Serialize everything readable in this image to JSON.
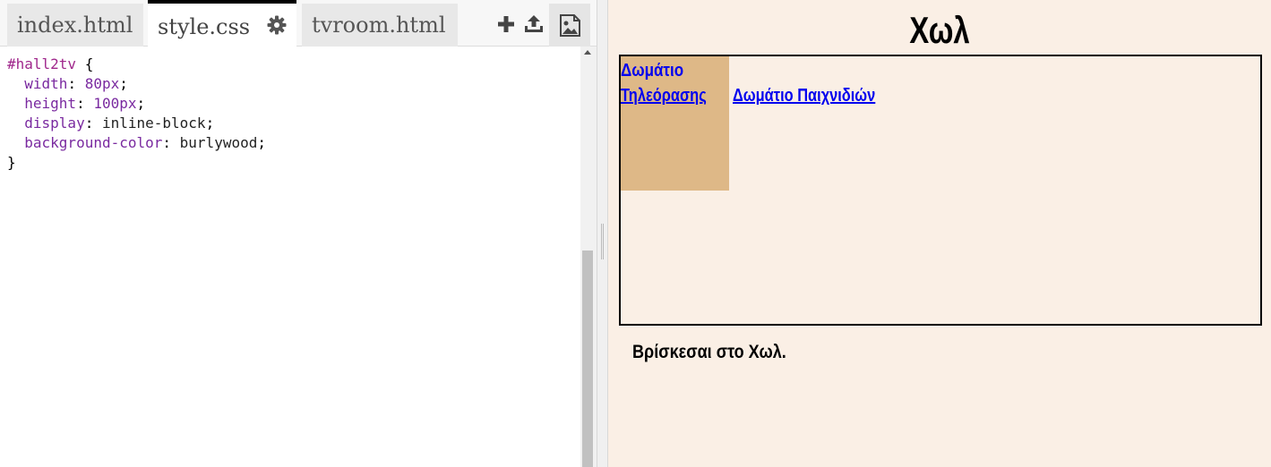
{
  "editor": {
    "tabs": [
      {
        "label": "index.html",
        "active": false
      },
      {
        "label": "style.css",
        "active": true
      },
      {
        "label": "tvroom.html",
        "active": false
      }
    ],
    "icons": [
      "gear-icon",
      "add-icon",
      "upload-icon",
      "image-icon"
    ],
    "code": {
      "selector": "#hall2tv",
      "open_brace": " {",
      "close_brace": "}",
      "rules": [
        {
          "prop": "width",
          "value": "80px"
        },
        {
          "prop": "height",
          "value": "100px"
        },
        {
          "prop": "display",
          "value": "inline-block"
        },
        {
          "prop": "background-color",
          "value": "burlywood"
        }
      ]
    }
  },
  "preview": {
    "title": "Χωλ",
    "tv_link": {
      "line1": "Δωμάτιο",
      "line2": "Τηλεόρασης"
    },
    "playroom_link": "Δωμάτιο Παιχνιδιών",
    "status": "Βρίσκεσαι στο Χωλ.",
    "colors": {
      "background": "#faefe5",
      "tv_box": "#deb887",
      "link": "#0000ee"
    }
  }
}
